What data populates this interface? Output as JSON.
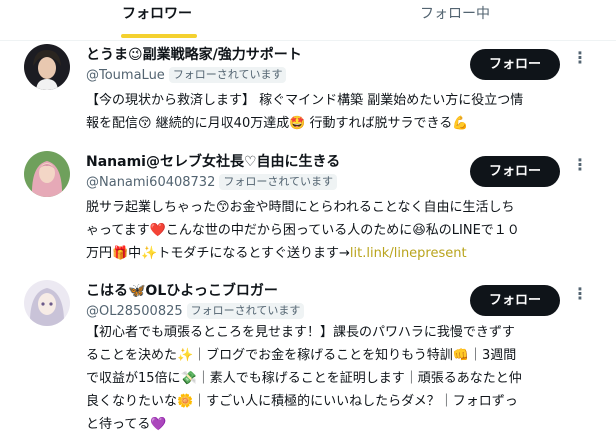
{
  "tabs": {
    "followers": "フォロワー",
    "following": "フォロー中"
  },
  "follow_label": "フォロー",
  "followed_badge": "フォローされています",
  "users": [
    {
      "name": "とうま😉副業戦略家/強力サポート",
      "handle": "@ToumaLue",
      "bio_lines": [
        "【今の現状から救済します】 稼ぐマインド構築 副業始めたい方に役立つ情",
        "報を配信😚 継続的に月収40万達成🤩 行動すれば脱サラできる💪"
      ]
    },
    {
      "name": "Nanami@セレブ女社長♡自由に生きる",
      "handle": "@Nanami60408732",
      "bio_lines": [
        "脱サラ起業しちゃった😙お金や時間にとらわれることなく自由に生活しち",
        "ゃってます❤️こんな世の中だから困っている人のために😆私のLINEで１０",
        "万円🎁中✨トモダチになるとすぐ送ります→"
      ],
      "bio_link": "lit.link/linepresent"
    },
    {
      "name": "こはる🦋OLひよっこブロガー",
      "handle": "@OL28500825",
      "bio_lines": [
        "【初心者でも頑張るところを見せます！】課長のパワハラに我慢できずす",
        "ることを決めた✨｜ブログでお金を稼げることを知りもう特訓👊｜3週間",
        "で収益が15倍に💸｜素人でも稼げることを証明します｜頑張るあなたと仲",
        "良くなりたいな🌼｜すごい人に積極的にいいねしたらダメ？｜フォロずっ",
        "と待ってる💜"
      ]
    }
  ]
}
